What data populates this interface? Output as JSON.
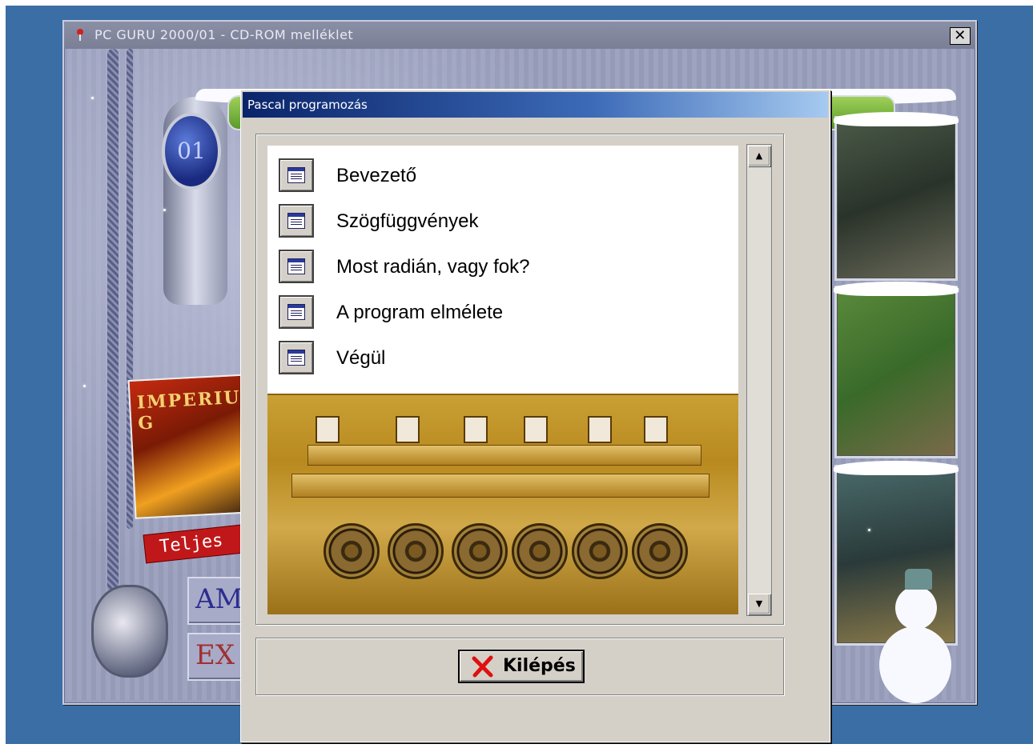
{
  "main_window": {
    "title": "PC GURU 2000/01 - CD-ROM melléklet",
    "close_glyph": "✕",
    "badge_text": "01",
    "box_text": "IMPERIUM G",
    "banner_text": "Teljes",
    "plate_1_text": "AMI",
    "plate_2_text": "EX"
  },
  "dialog": {
    "title": "Pascal programozás",
    "items": [
      {
        "label": "Bevezető",
        "icon": "document-icon"
      },
      {
        "label": "Szögfüggvények",
        "icon": "document-icon"
      },
      {
        "label": "Most radián, vagy fok?",
        "icon": "document-icon"
      },
      {
        "label": "A program elmélete",
        "icon": "document-icon"
      },
      {
        "label": "Végül",
        "icon": "document-icon"
      }
    ],
    "image": "pascaline-calculator",
    "scroll_up_glyph": "▲",
    "scroll_down_glyph": "▼",
    "exit_label": "Kilépés"
  },
  "colors": {
    "desktop": "#3a6ea5",
    "dialog_title_start": "#0a246a",
    "dialog_title_end": "#a6caf0",
    "exit_x": "#e01010"
  }
}
